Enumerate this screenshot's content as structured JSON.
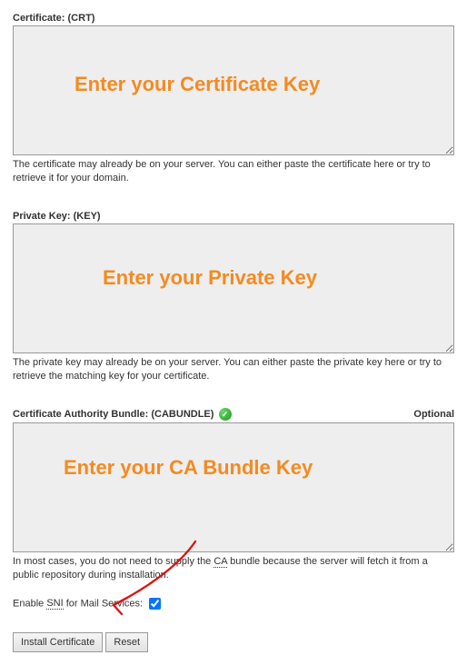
{
  "cert": {
    "label": "Certificate: (CRT)",
    "help": "The certificate may already be on your server. You can either paste the certificate here or try to retrieve it for your domain.",
    "overlay": "Enter your Certificate Key"
  },
  "key": {
    "label": "Private Key: (KEY)",
    "help": "The private key may already be on your server. You can either paste the private key here or try to retrieve the matching key for your certificate.",
    "overlay": "Enter your Private Key"
  },
  "bundle": {
    "label": "Certificate Authority Bundle: (CABUNDLE)",
    "optional": "Optional",
    "help_pre": "In most cases, you do not need to supply the ",
    "help_dotted": "CA",
    "help_post": " bundle because the server will fetch it from a public repository during installation.",
    "overlay": "Enter your CA Bundle Key"
  },
  "sni": {
    "pre": "Enable ",
    "dotted": "SNI",
    "post": " for Mail Services:",
    "checked": true
  },
  "buttons": {
    "install": "Install Certificate",
    "reset": "Reset"
  }
}
